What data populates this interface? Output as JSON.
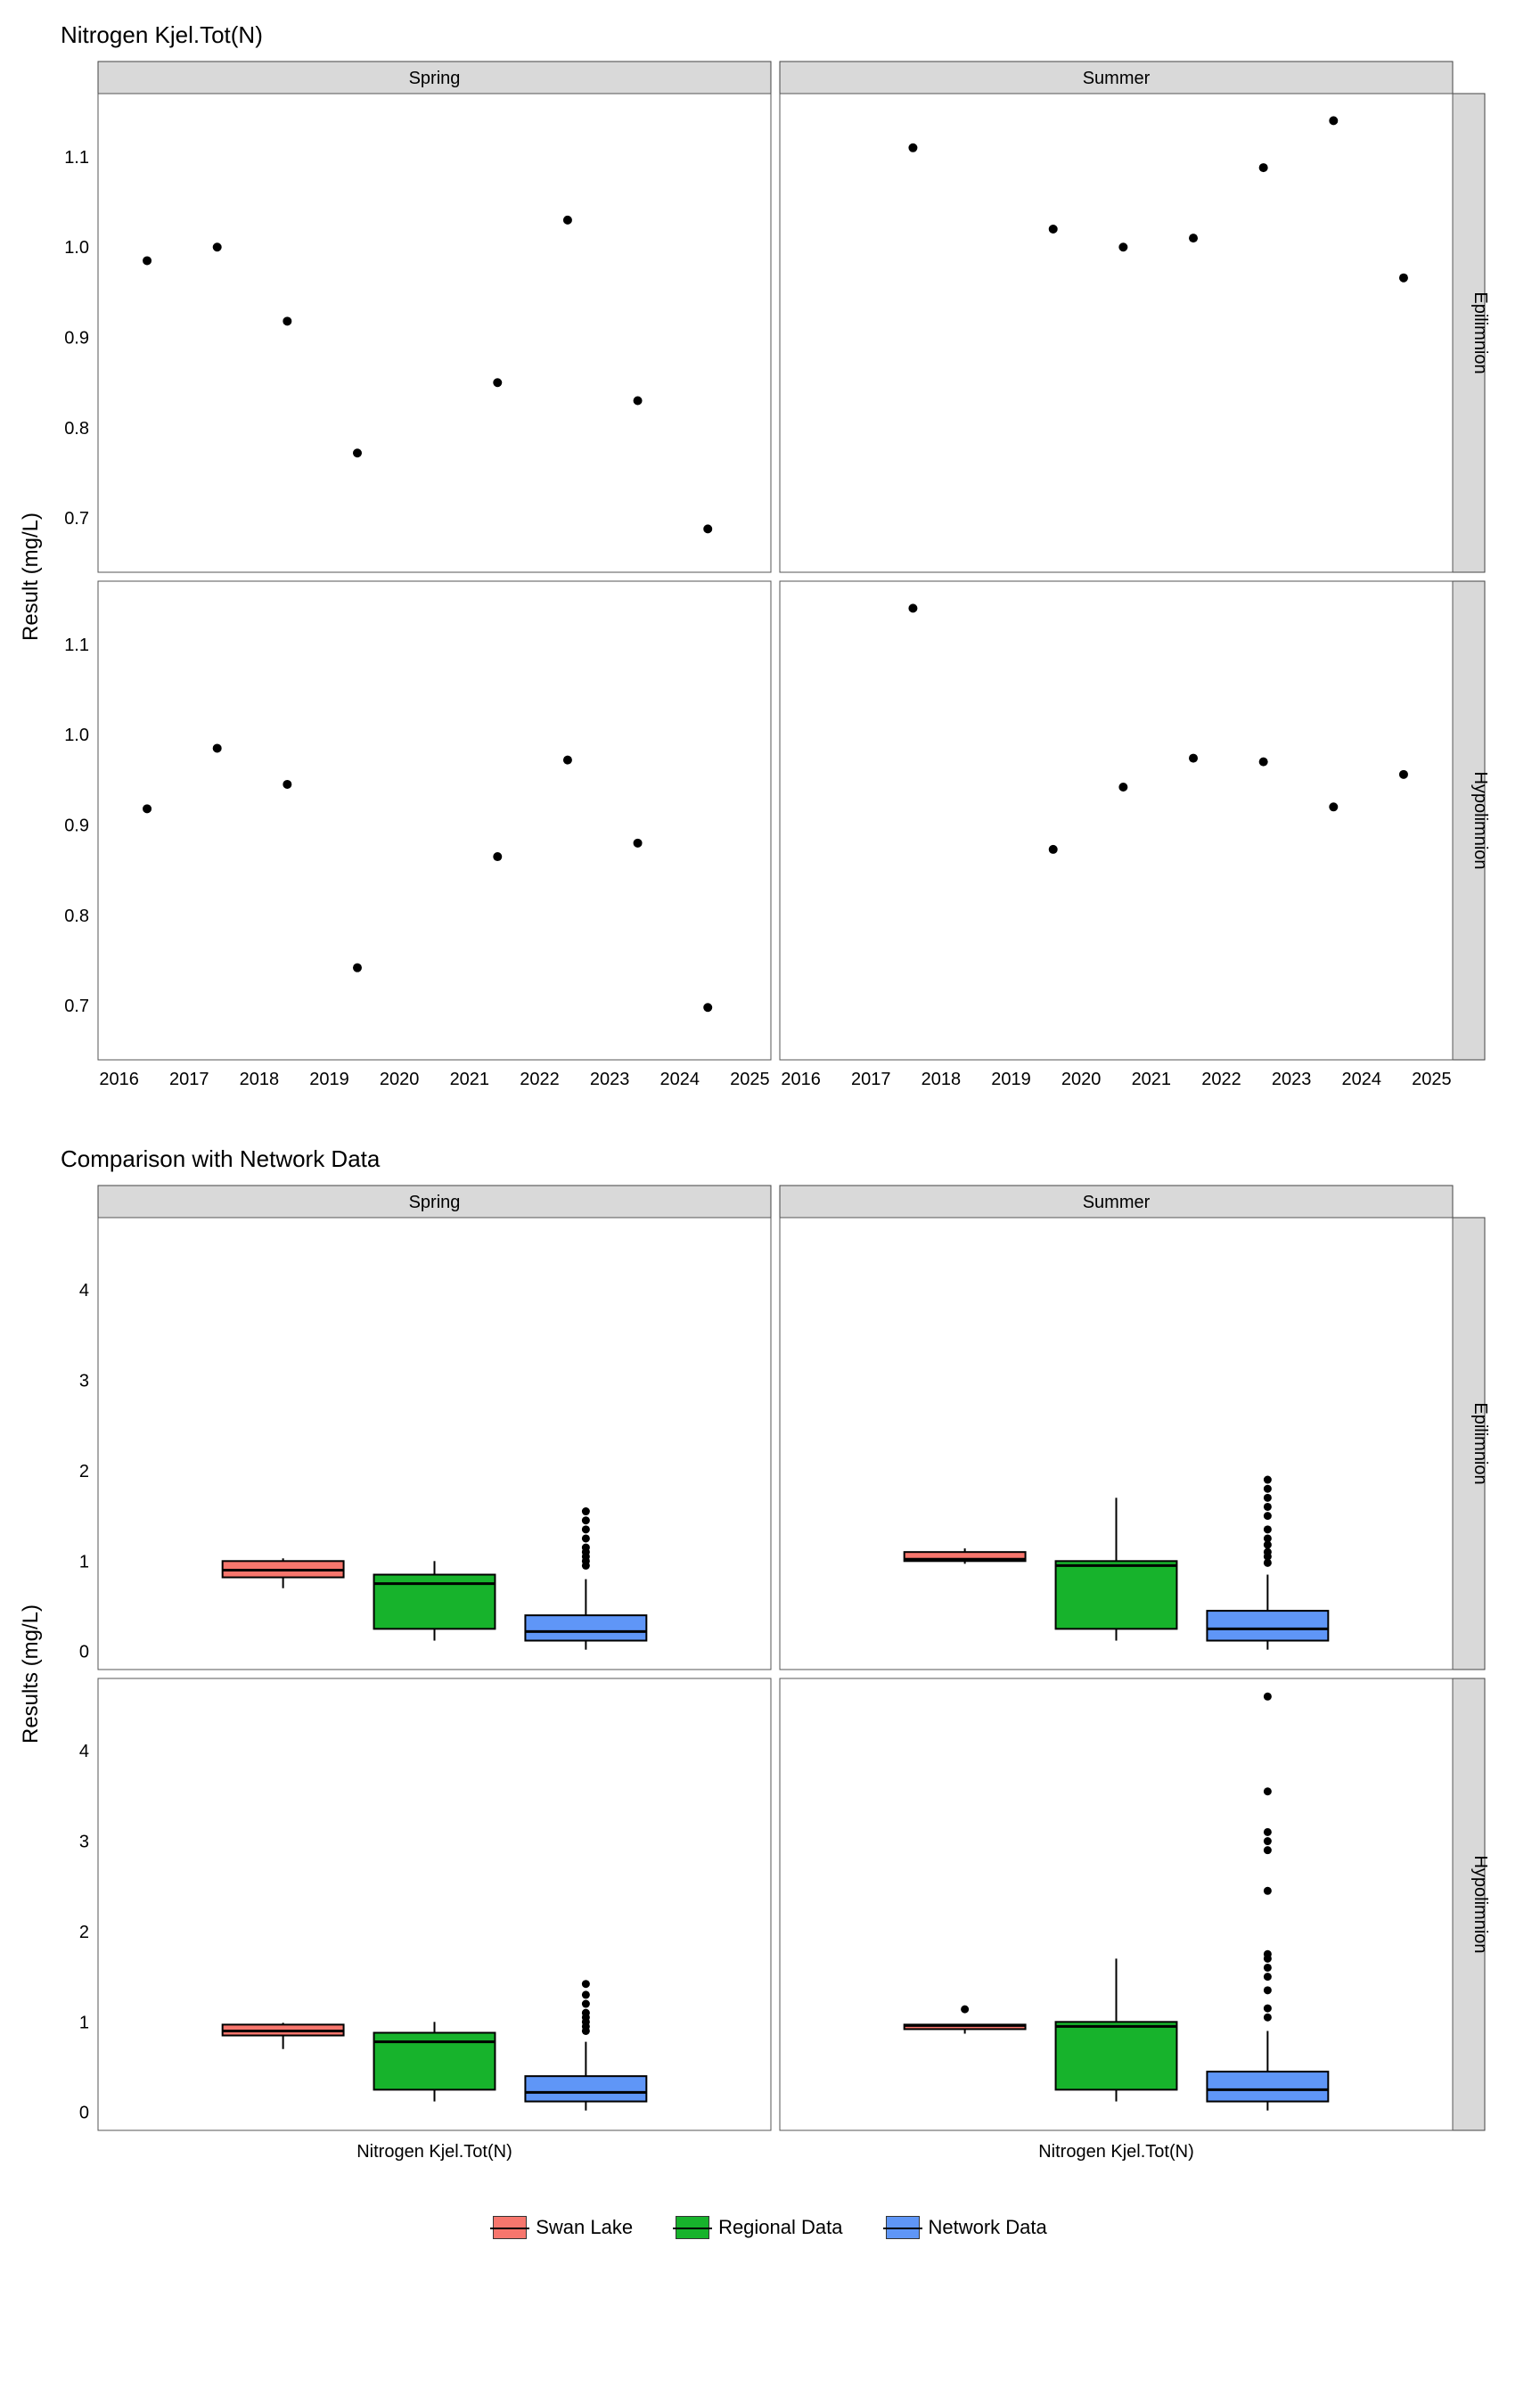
{
  "block1": {
    "title": "Nitrogen Kjel.Tot(N)",
    "y_axis": "Result (mg/L)",
    "col_labels": [
      "Spring",
      "Summer"
    ],
    "row_labels": [
      "Epilimnion",
      "Hypolimnion"
    ],
    "x_ticks": [
      2016,
      2017,
      2018,
      2019,
      2020,
      2021,
      2022,
      2023,
      2024,
      2025
    ],
    "y_ticks": [
      0.7,
      0.8,
      0.9,
      1.0,
      1.1
    ],
    "x_range": [
      2015.7,
      2025.3
    ],
    "y_range": [
      0.64,
      1.17
    ]
  },
  "block2": {
    "title": "Comparison with Network Data",
    "y_axis": "Results (mg/L)",
    "col_labels": [
      "Spring",
      "Summer"
    ],
    "row_labels": [
      "Epilimnion",
      "Hypolimnion"
    ],
    "x_tick_label": "Nitrogen Kjel.Tot(N)",
    "y_ticks": [
      0,
      1,
      2,
      3,
      4
    ],
    "y_range": [
      -0.2,
      4.8
    ]
  },
  "legend": [
    {
      "label": "Swan Lake",
      "cls": "sw-swan"
    },
    {
      "label": "Regional Data",
      "cls": "sw-reg"
    },
    {
      "label": "Network Data",
      "cls": "sw-net"
    }
  ],
  "chart_data": [
    {
      "type": "scatter",
      "title": "Nitrogen Kjel.Tot(N)",
      "xlabel": "",
      "ylabel": "Result (mg/L)",
      "facets": {
        "cols": [
          "Spring",
          "Summer"
        ],
        "rows": [
          "Epilimnion",
          "Hypolimnion"
        ]
      },
      "xlim": [
        2015.7,
        2025.3
      ],
      "ylim": [
        0.64,
        1.17
      ],
      "series": [
        {
          "facet_col": "Spring",
          "facet_row": "Epilimnion",
          "points": [
            {
              "x": 2016.4,
              "y": 0.985
            },
            {
              "x": 2017.4,
              "y": 1.0
            },
            {
              "x": 2018.4,
              "y": 0.918
            },
            {
              "x": 2019.4,
              "y": 0.772
            },
            {
              "x": 2021.4,
              "y": 0.85
            },
            {
              "x": 2022.4,
              "y": 1.03
            },
            {
              "x": 2023.4,
              "y": 0.83
            },
            {
              "x": 2024.4,
              "y": 0.688
            }
          ]
        },
        {
          "facet_col": "Spring",
          "facet_row": "Hypolimnion",
          "points": [
            {
              "x": 2016.4,
              "y": 0.918
            },
            {
              "x": 2017.4,
              "y": 0.985
            },
            {
              "x": 2018.4,
              "y": 0.945
            },
            {
              "x": 2019.4,
              "y": 0.742
            },
            {
              "x": 2021.4,
              "y": 0.865
            },
            {
              "x": 2022.4,
              "y": 0.972
            },
            {
              "x": 2023.4,
              "y": 0.88
            },
            {
              "x": 2024.4,
              "y": 0.698
            }
          ]
        },
        {
          "facet_col": "Summer",
          "facet_row": "Epilimnion",
          "points": [
            {
              "x": 2017.6,
              "y": 1.11
            },
            {
              "x": 2019.6,
              "y": 1.02
            },
            {
              "x": 2020.6,
              "y": 1.0
            },
            {
              "x": 2021.6,
              "y": 1.01
            },
            {
              "x": 2022.6,
              "y": 1.088
            },
            {
              "x": 2023.6,
              "y": 1.14
            },
            {
              "x": 2024.6,
              "y": 0.966
            }
          ]
        },
        {
          "facet_col": "Summer",
          "facet_row": "Hypolimnion",
          "points": [
            {
              "x": 2017.6,
              "y": 1.14
            },
            {
              "x": 2019.6,
              "y": 0.873
            },
            {
              "x": 2020.6,
              "y": 0.942
            },
            {
              "x": 2021.6,
              "y": 0.974
            },
            {
              "x": 2022.6,
              "y": 0.97
            },
            {
              "x": 2023.6,
              "y": 0.92
            },
            {
              "x": 2024.6,
              "y": 0.956
            }
          ]
        }
      ]
    },
    {
      "type": "box",
      "title": "Comparison with Network Data",
      "xlabel": "",
      "ylabel": "Results (mg/L)",
      "x_category": "Nitrogen Kjel.Tot(N)",
      "facets": {
        "cols": [
          "Spring",
          "Summer"
        ],
        "rows": [
          "Epilimnion",
          "Hypolimnion"
        ]
      },
      "ylim": [
        -0.2,
        4.8
      ],
      "groups": [
        "Swan Lake",
        "Regional Data",
        "Network Data"
      ],
      "colors": {
        "Swan Lake": "#f7766d",
        "Regional Data": "#17b32c",
        "Network Data": "#5f96f7"
      },
      "panels": {
        "Spring|Epilimnion": {
          "Swan Lake": {
            "low": 0.7,
            "q1": 0.82,
            "med": 0.9,
            "q3": 1.0,
            "high": 1.03,
            "out": []
          },
          "Regional Data": {
            "low": 0.12,
            "q1": 0.25,
            "med": 0.75,
            "q3": 0.85,
            "high": 1.0,
            "out": []
          },
          "Network Data": {
            "low": 0.02,
            "q1": 0.12,
            "med": 0.22,
            "q3": 0.4,
            "high": 0.8,
            "out": [
              0.95,
              1.0,
              1.05,
              1.1,
              1.15,
              1.25,
              1.35,
              1.45,
              1.55
            ]
          }
        },
        "Spring|Hypolimnion": {
          "Swan Lake": {
            "low": 0.7,
            "q1": 0.85,
            "med": 0.9,
            "q3": 0.97,
            "high": 0.99,
            "out": []
          },
          "Regional Data": {
            "low": 0.12,
            "q1": 0.25,
            "med": 0.78,
            "q3": 0.88,
            "high": 1.0,
            "out": []
          },
          "Network Data": {
            "low": 0.02,
            "q1": 0.12,
            "med": 0.22,
            "q3": 0.4,
            "high": 0.78,
            "out": [
              0.9,
              0.95,
              1.0,
              1.05,
              1.1,
              1.2,
              1.3,
              1.42
            ]
          }
        },
        "Summer|Epilimnion": {
          "Swan Lake": {
            "low": 0.97,
            "q1": 1.0,
            "med": 1.02,
            "q3": 1.1,
            "high": 1.14,
            "out": []
          },
          "Regional Data": {
            "low": 0.12,
            "q1": 0.25,
            "med": 0.95,
            "q3": 1.0,
            "high": 1.7,
            "out": []
          },
          "Network Data": {
            "low": 0.02,
            "q1": 0.12,
            "med": 0.25,
            "q3": 0.45,
            "high": 0.85,
            "out": [
              0.98,
              1.05,
              1.1,
              1.18,
              1.25,
              1.35,
              1.5,
              1.6,
              1.7,
              1.8,
              1.9
            ]
          }
        },
        "Summer|Hypolimnion": {
          "Swan Lake": {
            "low": 0.87,
            "q1": 0.92,
            "med": 0.96,
            "q3": 0.97,
            "high": 0.97,
            "out": [
              1.14
            ]
          },
          "Regional Data": {
            "low": 0.12,
            "q1": 0.25,
            "med": 0.95,
            "q3": 1.0,
            "high": 1.7,
            "out": []
          },
          "Network Data": {
            "low": 0.02,
            "q1": 0.12,
            "med": 0.25,
            "q3": 0.45,
            "high": 0.9,
            "out": [
              1.05,
              1.15,
              1.35,
              1.5,
              1.6,
              1.7,
              1.75,
              2.45,
              2.9,
              3.0,
              3.1,
              3.55,
              4.6
            ]
          }
        }
      }
    }
  ]
}
